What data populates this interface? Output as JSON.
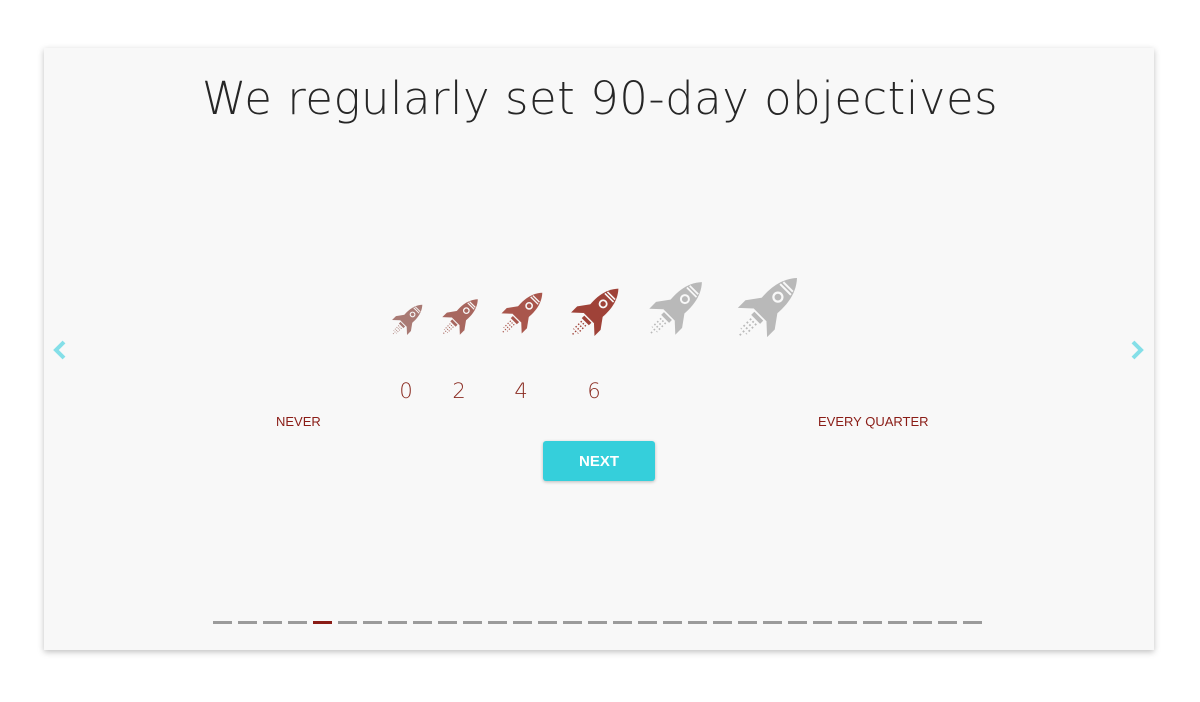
{
  "question": {
    "title": "We regularly set 90-day objectives"
  },
  "scale": {
    "min_label": "NEVER",
    "max_label": "EVERY QUARTER",
    "selected_value": 6,
    "numbers": [
      "0",
      "2",
      "4",
      "6"
    ],
    "rockets": [
      {
        "color": "#a97a74"
      },
      {
        "color": "#a8675f"
      },
      {
        "color": "#a9564c"
      },
      {
        "color": "#9f4238"
      },
      {
        "color": "#b9b9b9"
      },
      {
        "color": "#b9b9b9"
      }
    ]
  },
  "buttons": {
    "next_label": "NEXT"
  },
  "progress": {
    "total_steps": 31,
    "current_step": 5
  },
  "colors": {
    "accent": "#35cfdb",
    "arrow": "#84dfe8",
    "label": "#8a1c16",
    "dash": "#9b9b9b",
    "dash_active": "#8a1c16"
  }
}
